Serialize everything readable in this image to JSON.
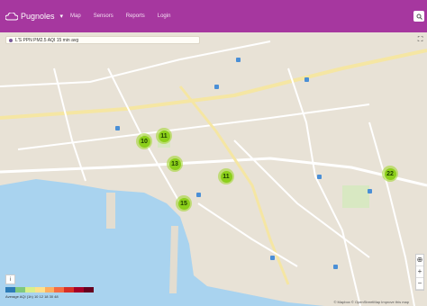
{
  "header": {
    "brand": "Pugnoles",
    "nav": [
      "Map",
      "Sensors",
      "Reports",
      "Login"
    ]
  },
  "map": {
    "info_text": "L'S PPN PM2.5 AQI 15 min avg",
    "clusters": [
      {
        "label": "10"
      },
      {
        "label": "11"
      },
      {
        "label": "13"
      },
      {
        "label": "11"
      },
      {
        "label": "15"
      },
      {
        "label": "22"
      }
    ],
    "legend_colors": [
      "#2c7bb6",
      "#7fc97f",
      "#d9ef8b",
      "#fee08b",
      "#fdae61",
      "#f46d43",
      "#d73027",
      "#a50026",
      "#67001f"
    ],
    "legend_caption": "Average AQI (1h) 10 12 18 30 48",
    "attribution": "© Mapbox © OpenStreetMap Improve this map",
    "zoom_in": "+",
    "zoom_out": "−",
    "colors": {
      "header": "#a6379f",
      "cluster": "#8ccf1a",
      "water": "#a9d3ef"
    }
  }
}
